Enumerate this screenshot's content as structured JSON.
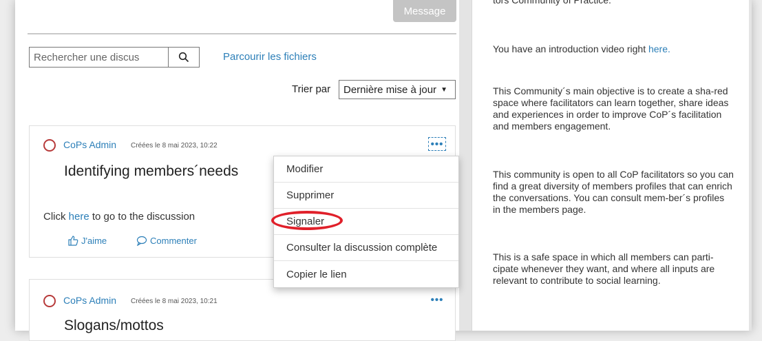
{
  "header": {
    "message_label": "Message"
  },
  "search": {
    "placeholder": "Rechercher une discus"
  },
  "files_link": "Parcourir les fichiers",
  "sort": {
    "label": "Trier par",
    "value": "Dernière mise à jour"
  },
  "posts": [
    {
      "author": "CoPs Admin",
      "date": "Créées le 8 mai 2023, 10:22",
      "title": "Identifying members´needs",
      "body_prefix": "Click ",
      "body_link": "here",
      "body_suffix": " to go to the discussion",
      "like_label": "J'aime",
      "comment_label": "Commenter"
    },
    {
      "author": "CoPs Admin",
      "date": "Créées le 8 mai 2023, 10:21",
      "title": "Slogans/mottos"
    }
  ],
  "menu": {
    "items": [
      "Modifier",
      "Supprimer",
      "Signaler",
      "Consulter la discussion complète",
      "Copier le lien"
    ]
  },
  "sidebar": {
    "top_fragment": "tors Community of Practice.",
    "video_prefix": "You have an introduction video right ",
    "video_link": "here.",
    "p1": "This Community´s main objective is to create a sha-red space where facilitators can learn together, share ideas and experiences in order to improve CoP´s facilitation and members engagement.",
    "p2": "This community is open to all CoP facilitators so you can find a great diversity of members profiles that can enrich the conversations. You can consult mem-ber´s profiles in the members page.",
    "p3": "This is a safe space in which all members can parti-cipate whenever they want, and where all inputs are relevant to contribute to social learning."
  },
  "colors": {
    "link": "#2c7fb8",
    "highlight": "#e0202a",
    "avatar_ring": "#b73a3a"
  }
}
